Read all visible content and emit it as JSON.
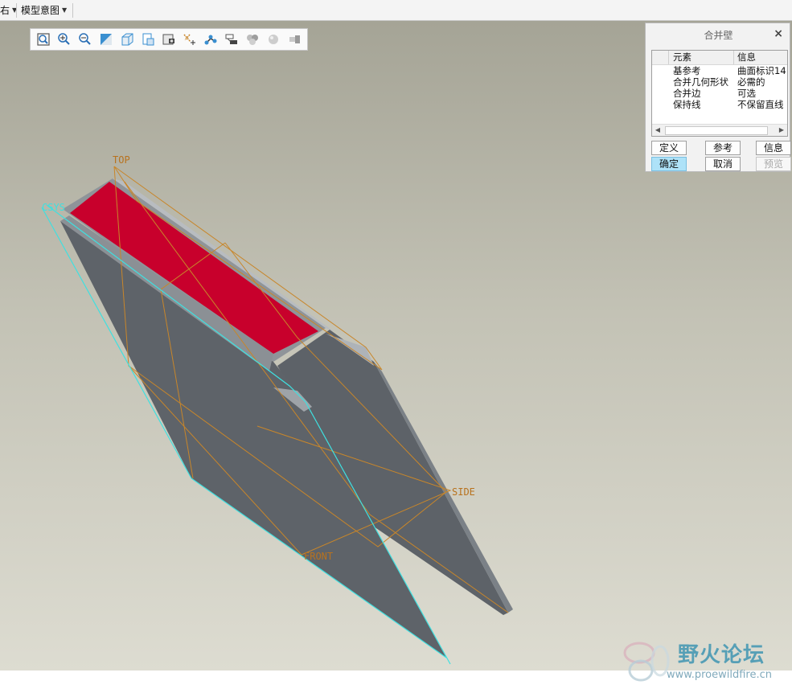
{
  "menu": {
    "partial_label": "右",
    "view_label": "模型意图"
  },
  "view_toolbar": {
    "buttons": [
      "zoom-refit-icon",
      "zoom-in-icon",
      "zoom-out-icon",
      "repaint-icon",
      "display-style-icon",
      "saved-views-icon",
      "view-manager-icon",
      "datum-display-icon",
      "spin-center-icon",
      "annotation-display-icon",
      "appearance-icon",
      "render-icon",
      "spin-icon"
    ]
  },
  "dialog": {
    "title": "合并壁",
    "close": "×",
    "table": {
      "headers": [
        "元素",
        "信息"
      ],
      "rows": [
        {
          "element": "基参考",
          "info": "曲面标识14"
        },
        {
          "element": "合并几何形状",
          "info": "必需的"
        },
        {
          "element": "合并边",
          "info": "可选"
        },
        {
          "element": "保持线",
          "info": "不保留直线"
        }
      ]
    },
    "buttons": {
      "define": "定义",
      "refs": "参考",
      "info": "信息",
      "ok": "确定",
      "cancel": "取消",
      "preview": "预览"
    }
  },
  "datums": {
    "top": "TOP",
    "side": "SIDE",
    "front": "FRONT",
    "origin": "CSYS"
  },
  "colors": {
    "highlight_face": "#c8002c",
    "model_body": "#5f646a",
    "datum_plane": "#c8862a",
    "selection_edge": "#3fe0e0",
    "dialog_active_button": "#aee2f8"
  },
  "watermark": {
    "title": "野火论坛",
    "url": "www.proewildfire.cn"
  }
}
